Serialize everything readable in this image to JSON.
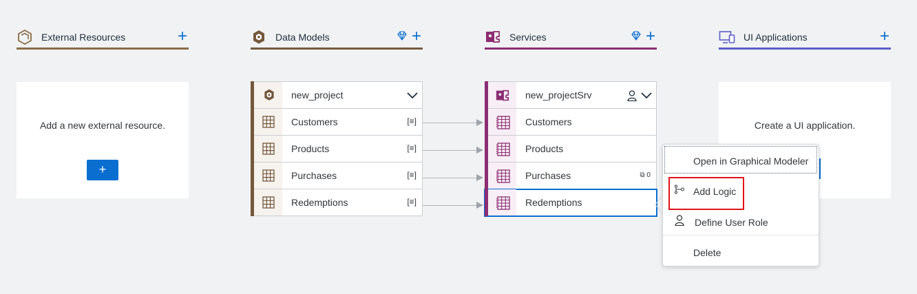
{
  "columns": {
    "external": {
      "title": "External Resources",
      "color": "#8a6b48"
    },
    "datamodels": {
      "title": "Data Models",
      "color": "#74583c"
    },
    "services": {
      "title": "Services",
      "color": "#8b2d73"
    },
    "uiapps": {
      "title": "UI Applications",
      "color": "#5b5cc8"
    }
  },
  "external_card": {
    "message": "Add a new external resource.",
    "add_button": "+"
  },
  "ui_card": {
    "message": "Create a UI application."
  },
  "data_model": {
    "project": "new_project",
    "entities": [
      "Customers",
      "Products",
      "Purchases",
      "Redemptions"
    ],
    "entity_indicator": "[≡]"
  },
  "service": {
    "project": "new_projectSrv",
    "entities": [
      "Customers",
      "Products",
      "Purchases",
      "Redemptions"
    ],
    "logic_indicator": "⧉ 0"
  },
  "context_menu": {
    "items": [
      "Open in Graphical Modeler",
      "Add Logic",
      "Define User Role",
      "Delete"
    ]
  },
  "icons": {
    "add": "plus-icon",
    "premium": "diamond-icon",
    "expand": "chevron-down-icon",
    "user": "person-icon",
    "table": "table-grid-icon",
    "logic": "logic-flow-icon"
  },
  "colors": {
    "accent": "#0a6ed1",
    "highlight": "#e0141a"
  }
}
